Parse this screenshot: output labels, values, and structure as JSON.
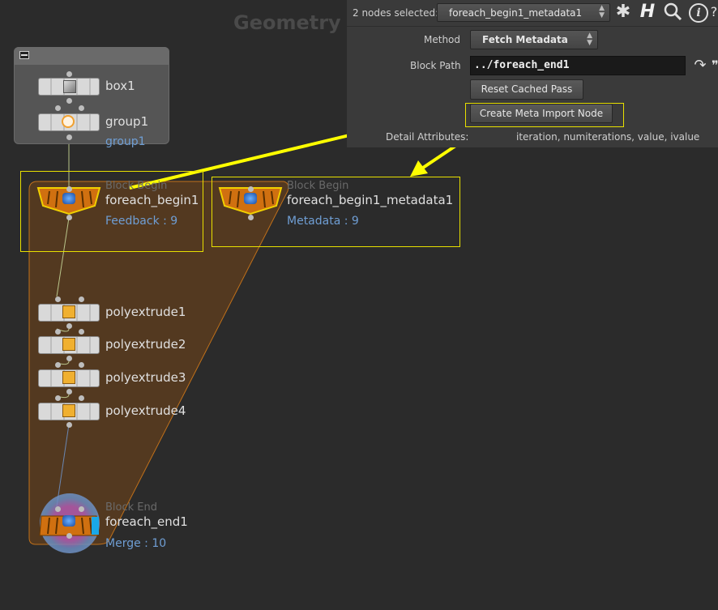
{
  "network": {
    "title": "Geometry"
  },
  "params": {
    "selection_label": "2 nodes selected:",
    "selected_node": "foreach_begin1_metadata1",
    "method_label": "Method",
    "method_value": "Fetch Metadata",
    "block_path_label": "Block Path",
    "block_path_value": "../foreach_end1",
    "reset_button": "Reset Cached Pass",
    "create_button": "Create Meta Import Node",
    "detail_label": "Detail Attributes:",
    "detail_value": "iteration, numiterations, value, ivalue"
  },
  "toolbar_icons": [
    "gear-icon",
    "houdini-h-icon",
    "search-icon",
    "info-icon"
  ],
  "nodes": {
    "box1": {
      "label": "box1"
    },
    "group1": {
      "label": "group1",
      "sub": "group1"
    },
    "foreach_begin1": {
      "type": "Block Begin",
      "label": "foreach_begin1",
      "sub": "Feedback : 9"
    },
    "metadata1": {
      "type": "Block Begin",
      "label": "foreach_begin1_metadata1",
      "sub": "Metadata : 9"
    },
    "polyextrude1": {
      "label": "polyextrude1"
    },
    "polyextrude2": {
      "label": "polyextrude2"
    },
    "polyextrude3": {
      "label": "polyextrude3"
    },
    "polyextrude4": {
      "label": "polyextrude4"
    },
    "foreach_end1": {
      "type": "Block End",
      "label": "foreach_end1",
      "sub": "Merge : 10"
    }
  },
  "colors": {
    "highlight": "#e8e000",
    "arrow": "#ffff00",
    "block_fill": "#5a3c1e",
    "block_stroke": "#c0701a",
    "node_orange": "#d07010",
    "link_blue": "#6f9ed4"
  }
}
